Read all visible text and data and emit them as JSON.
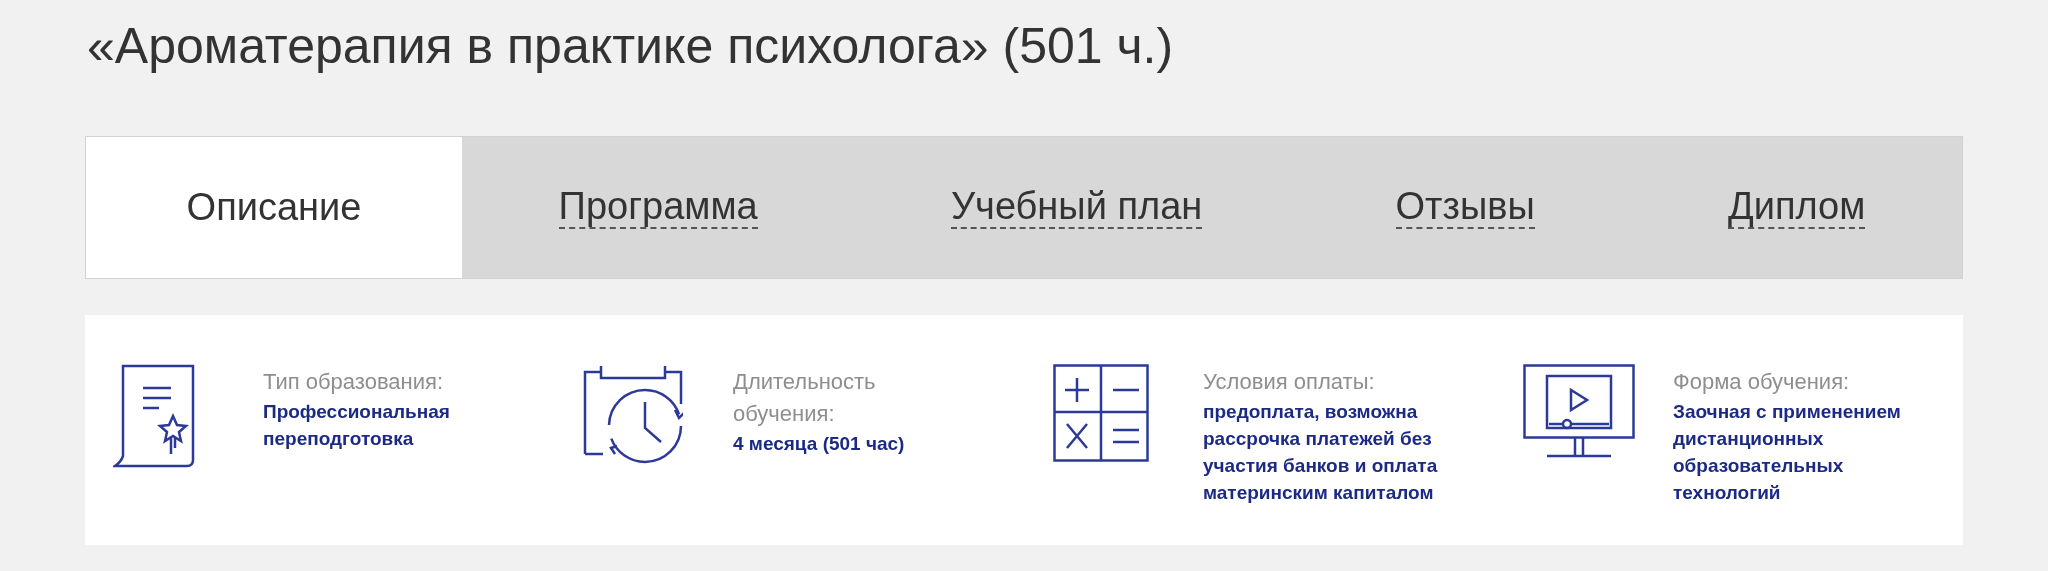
{
  "title": "«Ароматерапия в практике психолога» (501 ч.)",
  "tabs": [
    {
      "label": "Описание",
      "selected": true
    },
    {
      "label": "Программа",
      "selected": false
    },
    {
      "label": "Учебный план",
      "selected": false
    },
    {
      "label": "Отзывы",
      "selected": false
    },
    {
      "label": "Диплом",
      "selected": false
    }
  ],
  "info": [
    {
      "kind": "certificate",
      "label": "Тип образования:",
      "value": "Профессиональная переподготовка"
    },
    {
      "kind": "schedule",
      "label": "Длительность обучения:",
      "value": "4 месяца (501 час)"
    },
    {
      "kind": "calculator",
      "label": "Условия оплаты:",
      "value": "предоплата, возможна рассрочка платежей без участия банков и оплата материнским капиталом"
    },
    {
      "kind": "monitor",
      "label": "Форма обучения:",
      "value": "Заочная с применением дистанционных образовательных технологий"
    }
  ]
}
